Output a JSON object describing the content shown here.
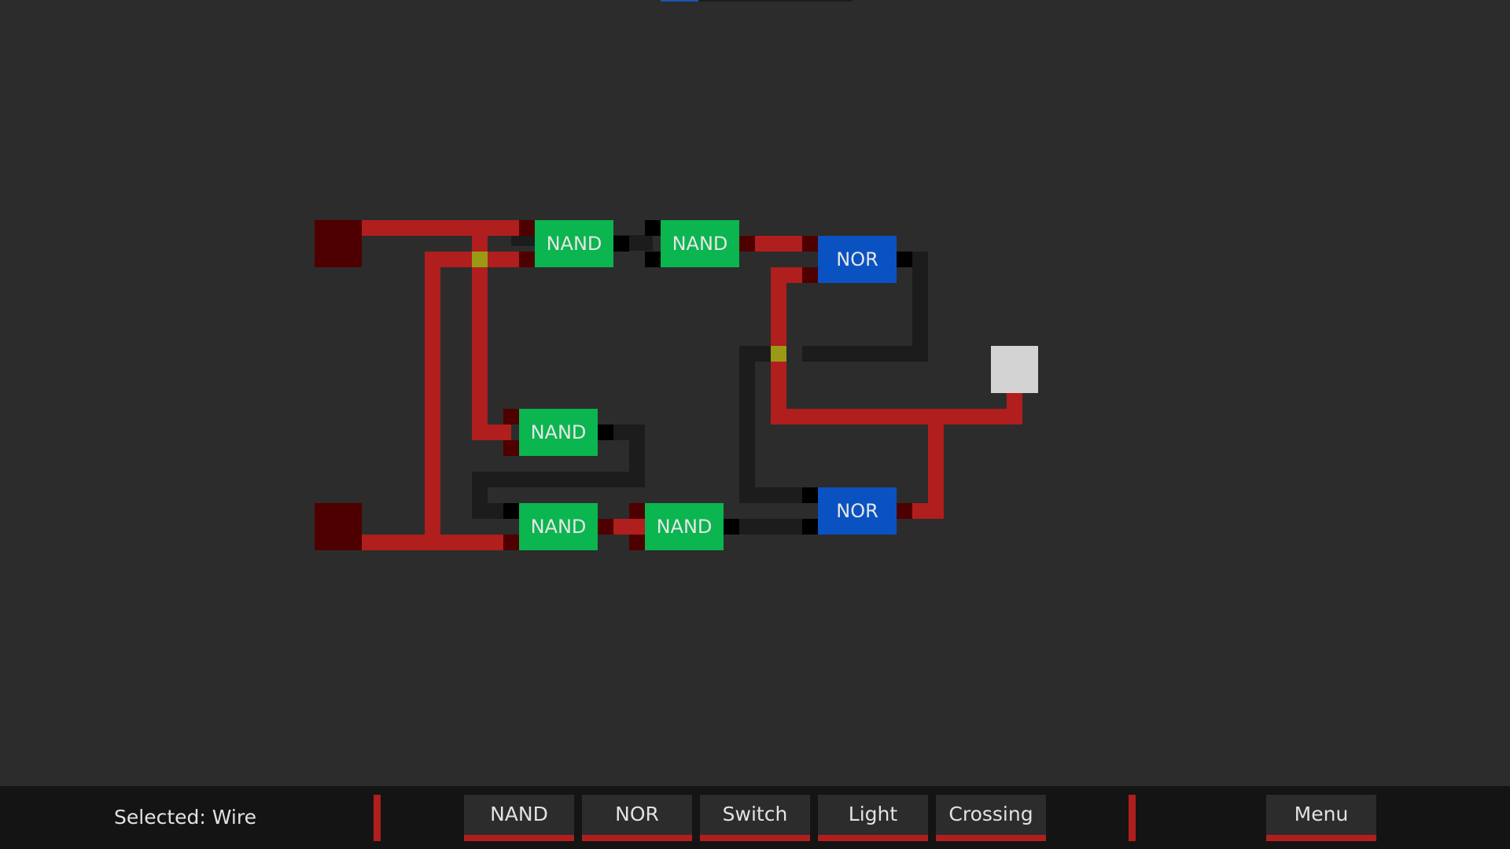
{
  "app": {
    "accent_color": "#b01e1e",
    "nand_color": "#0bb54f",
    "nor_color": "#0a52c2",
    "wire_on_color": "#b01e1e",
    "wire_off_color": "#1c1c1c",
    "background_color": "#2c2c2c"
  },
  "circuit": {
    "gates": [
      {
        "type": "NAND",
        "label": "NAND"
      },
      {
        "type": "NAND",
        "label": "NAND"
      },
      {
        "type": "NOR",
        "label": "NOR"
      },
      {
        "type": "NAND",
        "label": "NAND"
      },
      {
        "type": "NAND",
        "label": "NAND"
      },
      {
        "type": "NAND",
        "label": "NAND"
      },
      {
        "type": "NOR",
        "label": "NOR"
      }
    ],
    "switches": [
      {
        "name": "switch-a",
        "state": "off"
      },
      {
        "name": "switch-b",
        "state": "off"
      }
    ],
    "lights": [
      {
        "name": "output-light",
        "state": "off"
      }
    ]
  },
  "toolbar": {
    "status_prefix": "Selected: ",
    "selected_tool": "Wire",
    "status_text": "Selected: Wire",
    "tools": [
      "NAND",
      "NOR",
      "Switch",
      "Light",
      "Crossing"
    ],
    "menu_label": "Menu"
  }
}
